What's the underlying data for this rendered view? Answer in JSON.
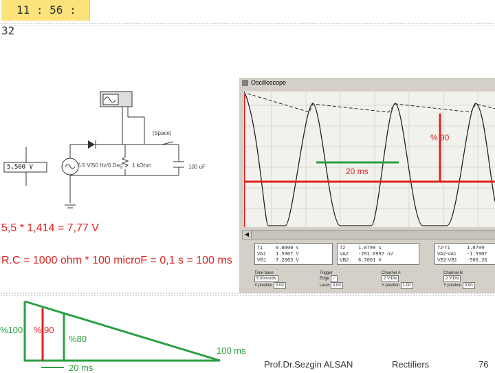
{
  "timer": "11 : 56 : 32",
  "circuit": {
    "meter_value": "5,500  V",
    "source_label": "5.5 V/50 Hz/0 Deg",
    "resistor_label": "1 kOhm",
    "capacitor_label": "100 uF",
    "switch_label": "[Space]"
  },
  "equations": {
    "peak": "5,5 * 1,414 = 7,77 V",
    "rc": "R.C = 1000 ohm * 100 microF = 0,1 s = 100 ms"
  },
  "oscilloscope": {
    "title": "Oscilloscope",
    "percent_label": "% 90",
    "period_label": "20 ms",
    "measurements": {
      "col1_labels": [
        "T1",
        "VA1",
        "VB1"
      ],
      "col1_values": [
        "0.0000 s",
        "1.5907 V",
        "7.2063 V"
      ],
      "col2_labels": [
        "T2",
        "VA2",
        "VB2"
      ],
      "col2_values": [
        "1.0799 s",
        "-291.6997 nV",
        "6.7001 V"
      ],
      "col3_labels": [
        "T2-T1",
        "VA2-VA1",
        "VB2-VB1"
      ],
      "col3_values": [
        "1.0799",
        "-1.5907",
        "-506.26"
      ]
    },
    "time_base": {
      "title": "Time base",
      "scale": "5.00ms/div",
      "xpos_label": "X position",
      "xpos": "0.00"
    },
    "trigger": {
      "title": "Trigger",
      "edge_label": "Edge",
      "level_label": "Level",
      "level": "0.00"
    },
    "channel_a": {
      "title": "Channel A",
      "scale": "2 V/Div",
      "ypos_label": "Y position",
      "ypos": "1.00"
    },
    "channel_b": {
      "title": "Channel B",
      "scale": "2 V/Div",
      "ypos_label": "Y position",
      "ypos": "0.00"
    }
  },
  "diagram": {
    "label_100": "%100",
    "label_90": "% 90",
    "label_80": "%80",
    "label_100ms": "100 ms",
    "label_20ms": "20 ms"
  },
  "footer": {
    "author": "Prof.Dr.Sezgin ALSAN",
    "topic": "Rectifiers",
    "page": "76"
  },
  "colors": {
    "red": "#e02020",
    "green": "#2aa040",
    "timer_bg": "#fbe27a"
  }
}
